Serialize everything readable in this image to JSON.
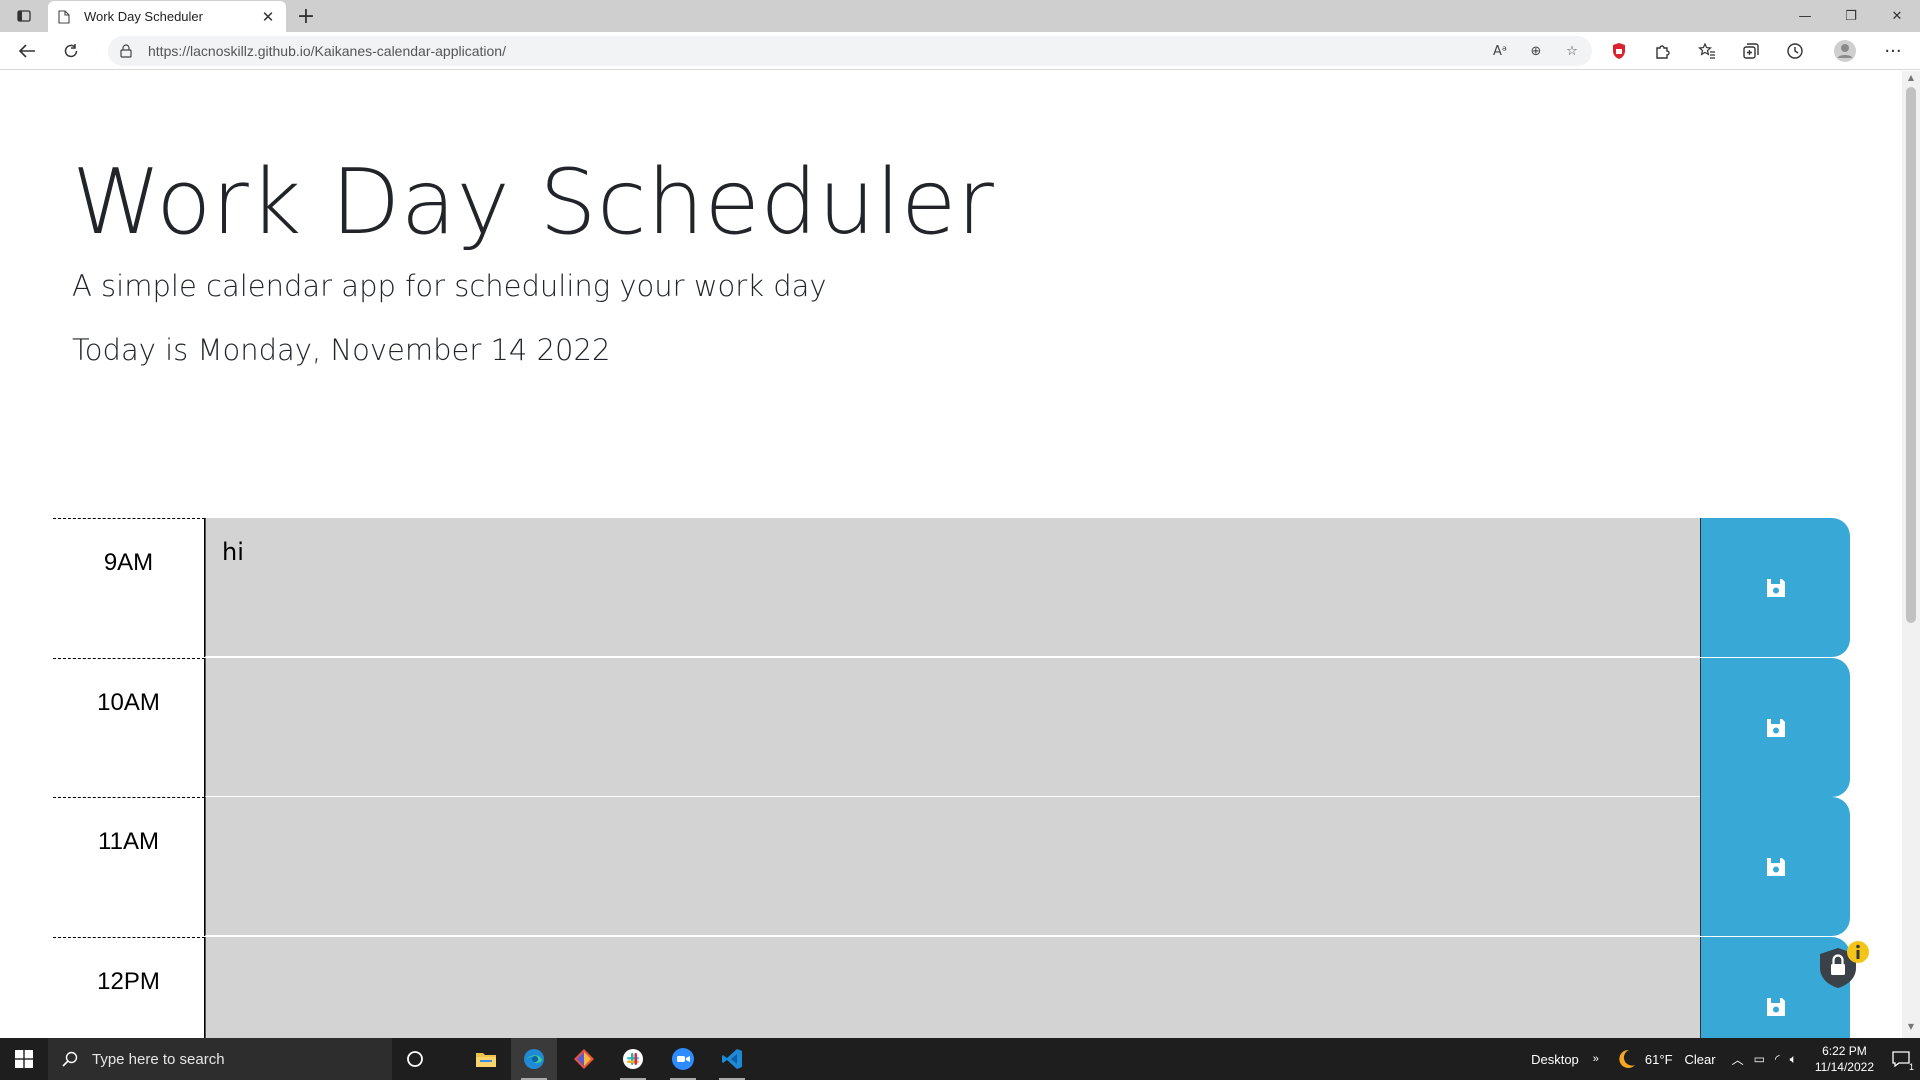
{
  "browser": {
    "tab_title": "Work Day Scheduler",
    "url": "https://lacnoskillz.github.io/Kaikanes-calendar-application/"
  },
  "page": {
    "title": "Work Day Scheduler",
    "lead": "A simple calendar app for scheduling your work day",
    "current_day": "Today is Monday, November 14 2022"
  },
  "time_blocks": [
    {
      "hour": "9AM",
      "text": "hi"
    },
    {
      "hour": "10AM",
      "text": ""
    },
    {
      "hour": "11AM",
      "text": ""
    },
    {
      "hour": "12PM",
      "text": ""
    }
  ],
  "colors": {
    "past": "#d3d3d3",
    "save_button": "#38a9d6"
  },
  "taskbar": {
    "search_placeholder": "Type here to search",
    "desktop_label": "Desktop",
    "weather_temp": "61°F",
    "weather_desc": "Clear",
    "time": "6:22 PM",
    "date": "11/14/2022",
    "notification_count": "1"
  }
}
